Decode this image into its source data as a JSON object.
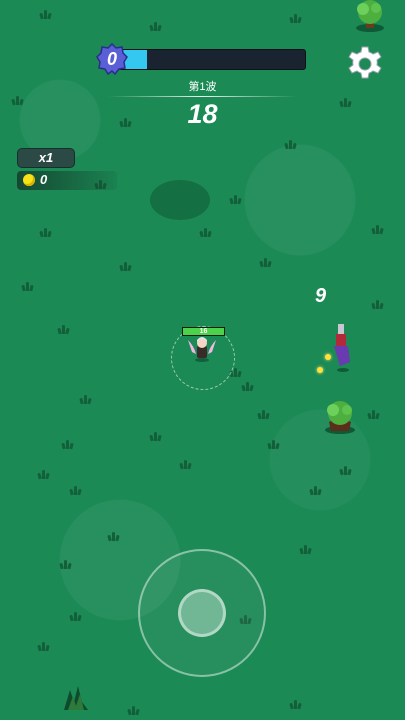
{
  "hud": {
    "level": "0",
    "xp_progress": 0.15,
    "xp_color": "#34c8f0",
    "wave_label": "第1波",
    "wave_timer": "18",
    "speed_multiplier": "x1",
    "coins": "0",
    "settings_icon": "gear-icon"
  },
  "player": {
    "hp_value": "16",
    "hp_fraction": 1.0,
    "hp_color": "#4dd24b"
  },
  "combat": {
    "damage_number": "9"
  },
  "colors": {
    "grass": "#1b8a55",
    "grass_tuft": "#135f3a",
    "level_badge": "#5a5fd6",
    "coin": "#f7e21a"
  }
}
